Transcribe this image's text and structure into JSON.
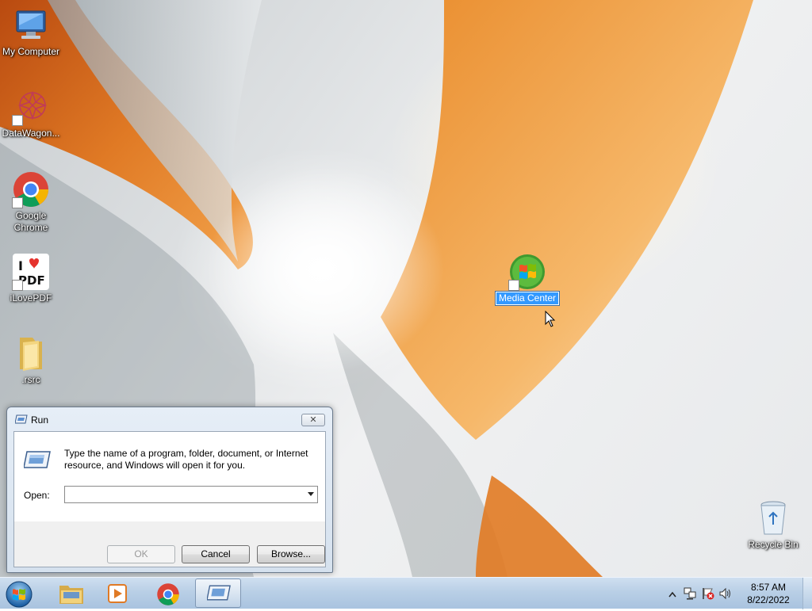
{
  "desktop": {
    "icons": [
      {
        "label": "My Computer",
        "icon": "computer-icon"
      },
      {
        "label": "DataWagon...",
        "icon": "datawagon-icon"
      },
      {
        "label": "Google Chrome",
        "icon": "chrome-icon"
      },
      {
        "label": "iLovePDF",
        "icon": "ilovepdf-icon"
      },
      {
        "label": ".rsrc",
        "icon": "folder-icon"
      },
      {
        "label": "Media Center",
        "icon": "media-center-icon",
        "selected": true
      },
      {
        "label": "Recycle Bin",
        "icon": "recycle-bin-icon"
      }
    ]
  },
  "run_dialog": {
    "title": "Run",
    "description": "Type the name of a program, folder, document, or Internet resource, and Windows will open it for you.",
    "open_label": "Open:",
    "open_value": "",
    "ok_label": "OK",
    "cancel_label": "Cancel",
    "browse_label": "Browse...",
    "close_glyph": "✕"
  },
  "taskbar": {
    "start_icon": "windows-orb-icon",
    "pinned": [
      "file-explorer-icon",
      "media-player-icon",
      "chrome-icon",
      "run-icon"
    ],
    "active": "run-icon",
    "tray": {
      "icons": [
        "show-hidden-icons-chevron",
        "network-icon",
        "action-center-flag-icon",
        "volume-icon"
      ],
      "time": "8:57 AM",
      "date": "8/22/2022"
    }
  }
}
